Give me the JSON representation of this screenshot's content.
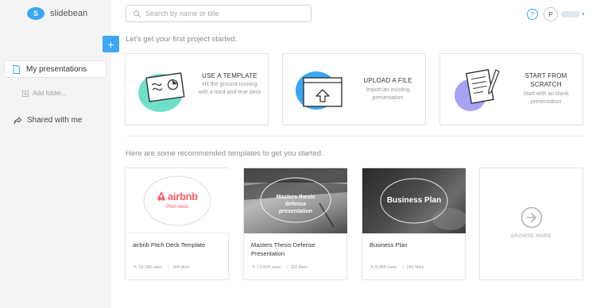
{
  "app": {
    "logo_letter": "S",
    "name": "slidebean"
  },
  "sidebar": {
    "items": [
      {
        "label": "My presentations",
        "icon": "document-icon"
      },
      {
        "label": "Add folder...",
        "icon": "add-folder-icon"
      },
      {
        "label": "Shared with me",
        "icon": "share-icon"
      }
    ],
    "new_button": "+"
  },
  "search": {
    "placeholder": "Search by name or title",
    "value": ""
  },
  "header": {
    "help_icon": "?",
    "avatar_letter": "P"
  },
  "start_section": {
    "title": "Let's get your first project started.",
    "cards": [
      {
        "title": "USE A TEMPLATE",
        "description": "Hit the ground running with a tried-and-true deck",
        "icon": "template-illustration"
      },
      {
        "title": "UPLOAD A FILE",
        "description": "Import an existing presentation",
        "icon": "upload-illustration"
      },
      {
        "title": "START FROM SCRATCH",
        "description": "Start with an blank presentation",
        "icon": "scratch-illustration"
      }
    ]
  },
  "templates_section": {
    "title": "Here are some recommended templates to get you started.",
    "templates": [
      {
        "name": "airbnb Pitch Deck Template",
        "thumb_title": "airbnb",
        "thumb_subtitle": "Pitch deck",
        "uses": "18,189 uses",
        "likes": "164 likes"
      },
      {
        "name": "Masters Thesis Defense Presentation",
        "thumb_title": "Masters thesis defense presentation",
        "thumb_subtitle": "",
        "uses": "13,424 uses",
        "likes": "110 likes"
      },
      {
        "name": "Business Plan",
        "thumb_title": "Business Plan",
        "thumb_subtitle": "",
        "uses": "8,956 uses",
        "likes": "142 likes"
      }
    ],
    "browse_label": "BROWSE MORE"
  },
  "colors": {
    "accent": "#3aa7f2",
    "brand_red": "#ff5a5f",
    "mint": "#6fe0c8",
    "lavender": "#a6a3f2"
  }
}
